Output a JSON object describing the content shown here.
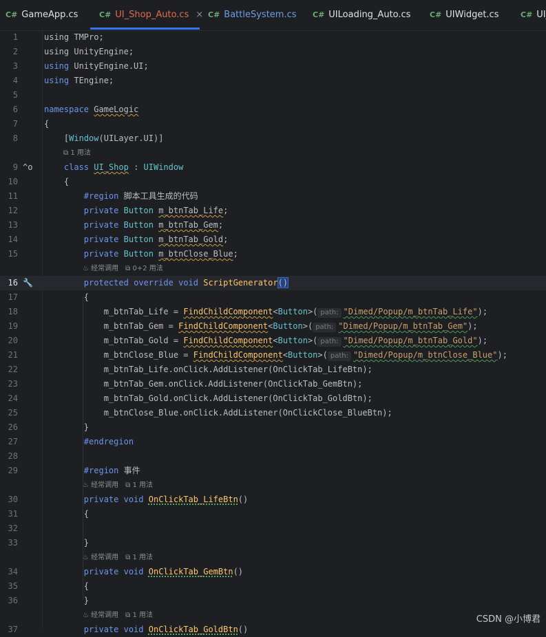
{
  "tabs": [
    {
      "label": "GameApp.cs",
      "lang": "C#"
    },
    {
      "label": "UI_Shop_Auto.cs",
      "lang": "C#",
      "close": "×"
    },
    {
      "label": "BattleSystem.cs",
      "lang": "C#"
    },
    {
      "label": "UILoading_Auto.cs",
      "lang": "C#"
    },
    {
      "label": "UIWidget.cs",
      "lang": "C#"
    },
    {
      "label": "UI_",
      "lang": "C#"
    }
  ],
  "lines": {
    "l1": "1",
    "l2": "2",
    "l3": "3",
    "l4": "4",
    "l5": "5",
    "l6": "6",
    "l7": "7",
    "l8": "8",
    "l9": "9",
    "l10": "10",
    "l11": "11",
    "l12": "12",
    "l13": "13",
    "l14": "14",
    "l15": "15",
    "l16": "16",
    "l17": "17",
    "l18": "18",
    "l19": "19",
    "l20": "20",
    "l21": "21",
    "l22": "22",
    "l23": "23",
    "l24": "24",
    "l25": "25",
    "l26": "26",
    "l27": "27",
    "l28": "28",
    "l29": "29",
    "l30": "30",
    "l31": "31",
    "l32": "32",
    "l33": "33",
    "l34": "34",
    "l35": "35",
    "l36": "36",
    "l37": "37"
  },
  "code": {
    "using": "using",
    "tmpro": "TMPro;",
    "unityengine": "UnityEngine;",
    "unityengineui": "UnityEngine.UI;",
    "tengine": "TEngine;",
    "namespace": "namespace",
    "gamelogic": "GameLogic",
    "lbrace": "{",
    "rbrace": "}",
    "attr_open": "[",
    "window": "Window",
    "attr_rest": "(UILayer.UI)]",
    "class": "class",
    "ui_shop": "UI_Shop",
    "colon": " : ",
    "uiwindow": "UIWindow",
    "region": "#region",
    "region1_name": "脚本工具生成的代码",
    "private": "private",
    "button": "Button",
    "f_life": "m_btnTab_Life",
    "f_gem": "m_btnTab_Gem",
    "f_gold": "m_btnTab_Gold",
    "f_close": "m_btnClose_Blue",
    "semi": ";",
    "protected": "protected",
    "override": "override",
    "void": "void",
    "scriptgen": "ScriptGenerator",
    "parens": "()",
    "eq": " = ",
    "findchild": "FindChildComponent",
    "lt": "<",
    "gt": ">(",
    "close_call": ");",
    "param_path": "path:",
    "s_life": "\"Dimed/Popup/m_btnTab_Life\"",
    "s_gem": "\"Dimed/Popup/m_btnTab_Gem\"",
    "s_gold": "\"Dimed/Popup/m_btnTab_Gold\"",
    "s_close": "\"Dimed/Popup/m_btnClose_Blue\"",
    "ls_life": "m_btnTab_Life.onClick.AddListener(OnClickTab_LifeBtn);",
    "ls_gem": "m_btnTab_Gem.onClick.AddListener(OnClickTab_GemBtn);",
    "ls_gold": "m_btnTab_Gold.onClick.AddListener(OnClickTab_GoldBtn);",
    "ls_close": "m_btnClose_Blue.onClick.AddListener(OnClickClose_BlueBtn);",
    "endregion": "#endregion",
    "region2_name": "事件",
    "m_life": "OnClickTab_LifeBtn",
    "m_gem": "OnClickTab_GemBtn",
    "m_gold_partial": "OnClickTab_GoldBtn"
  },
  "hints": {
    "one_usage": "1 用法",
    "frequent": "经常调用",
    "derived": "0+2 用法"
  },
  "watermark": "CSDN @小博君",
  "colors": {
    "accent": "#3574f0",
    "background": "#1e1f22",
    "keyword": "#cf8e6d",
    "string": "#c9a26d"
  }
}
